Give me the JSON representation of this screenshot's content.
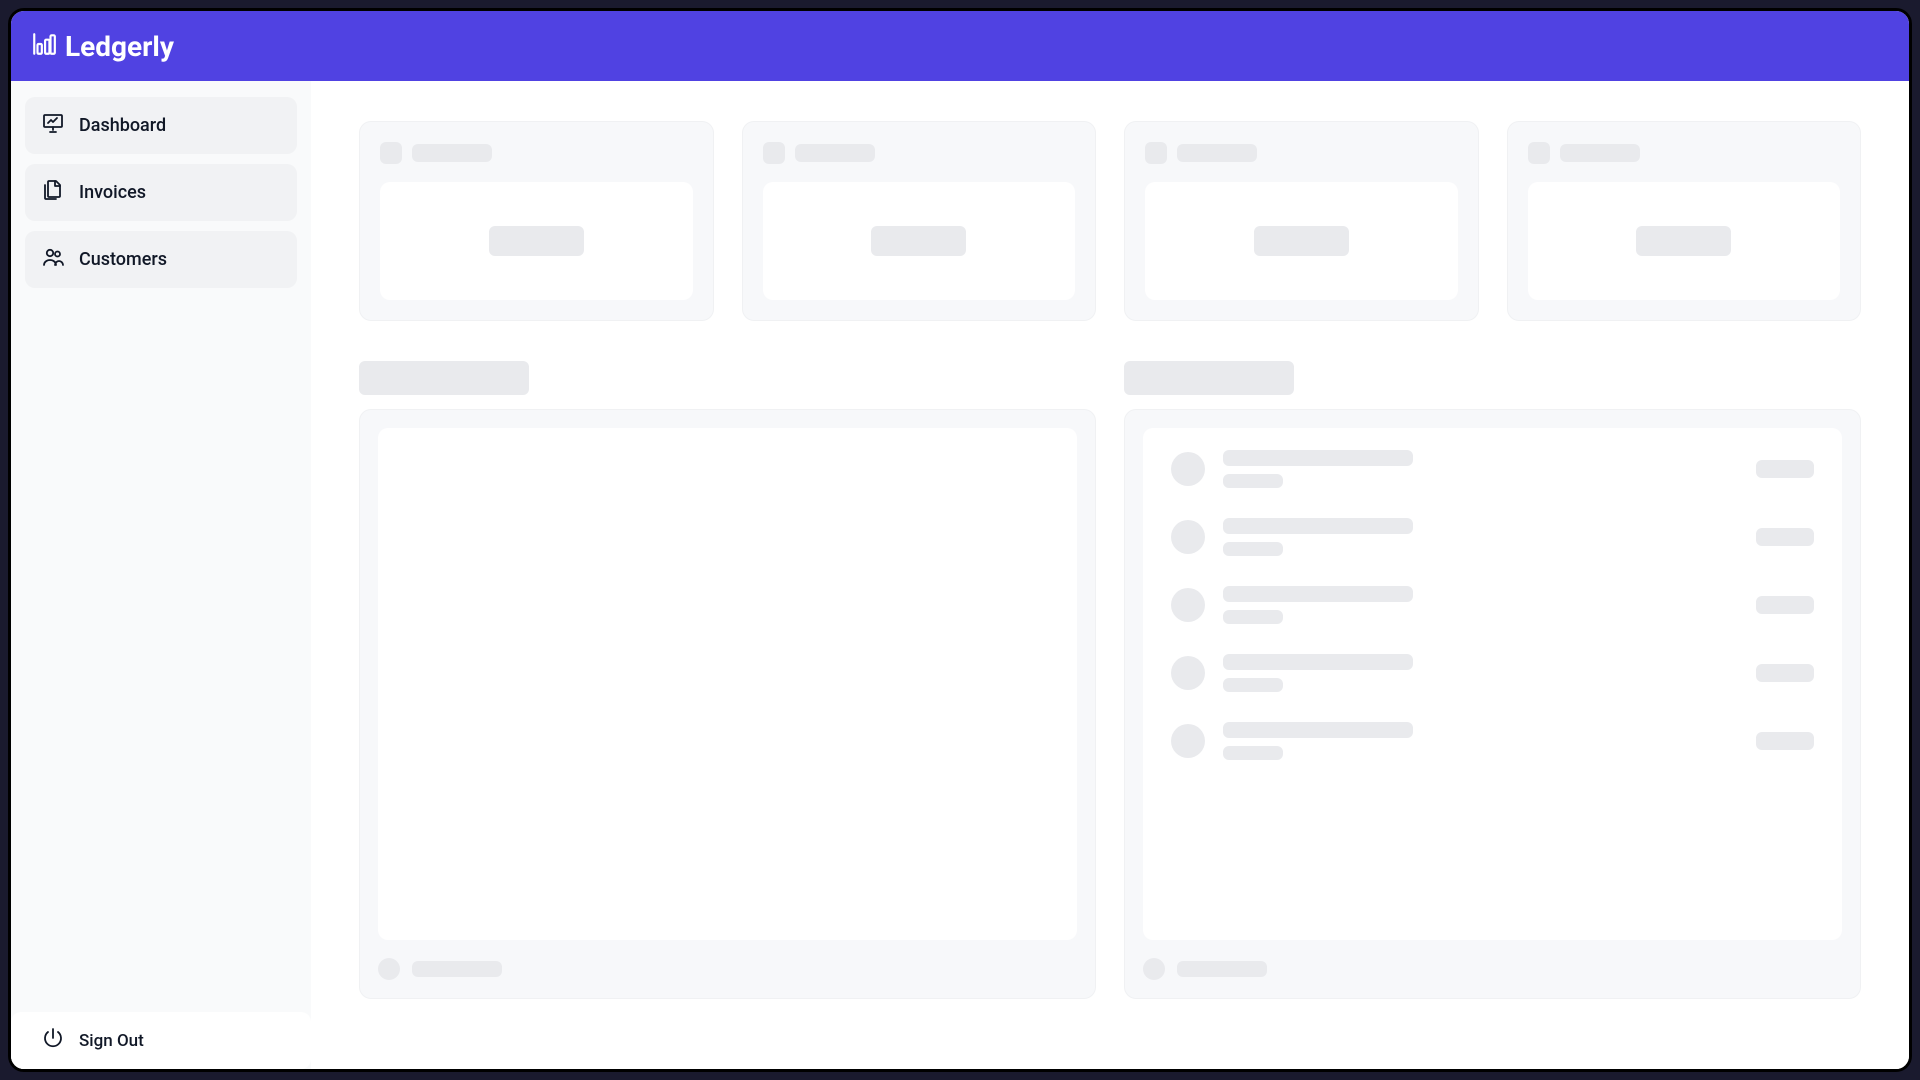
{
  "header": {
    "app_name": "Ledgerly"
  },
  "sidebar": {
    "items": [
      {
        "label": "Dashboard",
        "icon": "dashboard"
      },
      {
        "label": "Invoices",
        "icon": "invoices"
      },
      {
        "label": "Customers",
        "icon": "customers"
      }
    ],
    "signout_label": "Sign Out"
  },
  "main": {
    "state": "loading-skeleton",
    "stat_cards": [
      {
        "label": "",
        "value": ""
      },
      {
        "label": "",
        "value": ""
      },
      {
        "label": "",
        "value": ""
      },
      {
        "label": "",
        "value": ""
      }
    ],
    "section_titles": [
      "",
      ""
    ],
    "right_list_items": [
      {
        "name": "",
        "sub": "",
        "amount": ""
      },
      {
        "name": "",
        "sub": "",
        "amount": ""
      },
      {
        "name": "",
        "sub": "",
        "amount": ""
      },
      {
        "name": "",
        "sub": "",
        "amount": ""
      },
      {
        "name": "",
        "sub": "",
        "amount": ""
      }
    ]
  },
  "colors": {
    "brand": "#5042E2",
    "sidebar_bg": "#f9fafb",
    "sidebar_item_bg": "#f1f2f4",
    "skeleton": "#e9eaed",
    "panel_bg": "#f7f8fa"
  }
}
